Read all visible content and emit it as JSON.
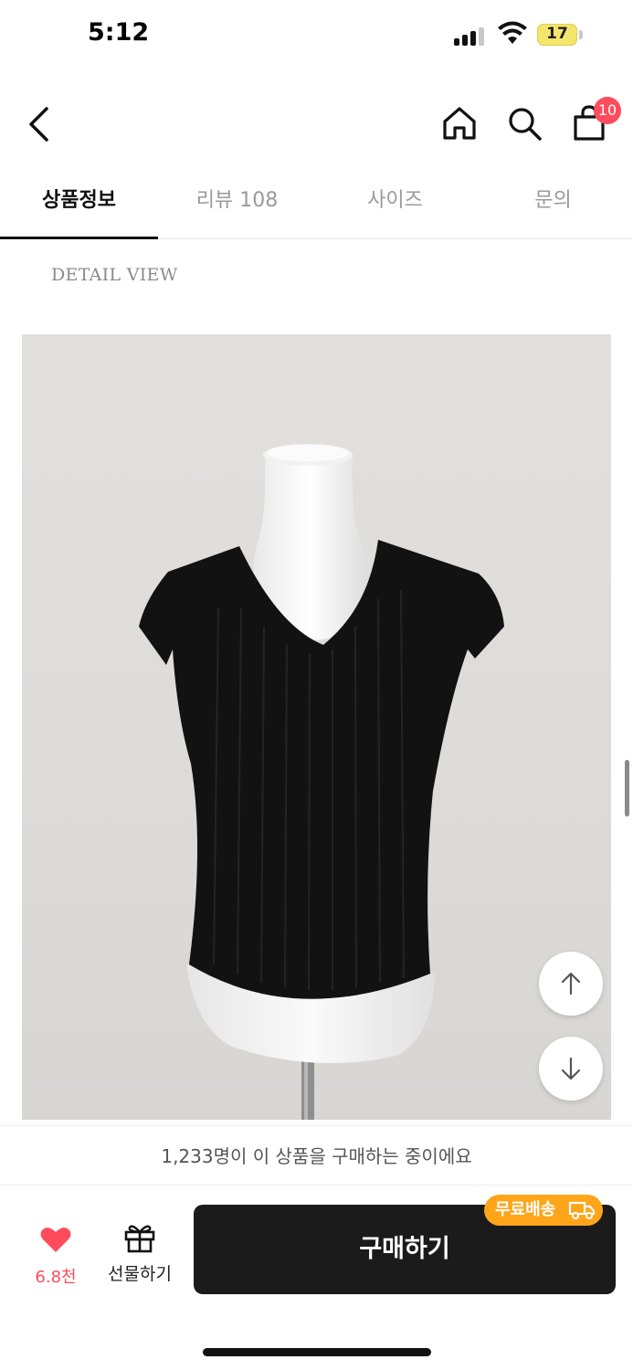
{
  "status_bar": {
    "time": "5:12",
    "battery": "17"
  },
  "header": {
    "back_icon": "chevron-left-icon",
    "home_icon": "home-icon",
    "search_icon": "search-icon",
    "cart_icon": "shopping-bag-icon",
    "cart_count": "10"
  },
  "tabs": [
    {
      "label": "상품정보",
      "active": true
    },
    {
      "label": "리뷰 108",
      "active": false
    },
    {
      "label": "사이즈",
      "active": false
    },
    {
      "label": "문의",
      "active": false
    }
  ],
  "content": {
    "detail_label": "DETAIL VIEW",
    "image_description_icon": "product-photo"
  },
  "floating": {
    "up_icon": "arrow-up-icon",
    "down_icon": "arrow-down-icon"
  },
  "notice": {
    "text": "1,233명이 이 상품을 구매하는 중이에요"
  },
  "bottom_bar": {
    "like_count": "6.8천",
    "gift_label": "선물하기",
    "buy_label": "구매하기",
    "free_shipping_label": "무료배송"
  },
  "colors": {
    "accent_pink": "#ff4b5c",
    "badge_orange": "#ffa51a",
    "buy_button": "#1b1b1b"
  }
}
